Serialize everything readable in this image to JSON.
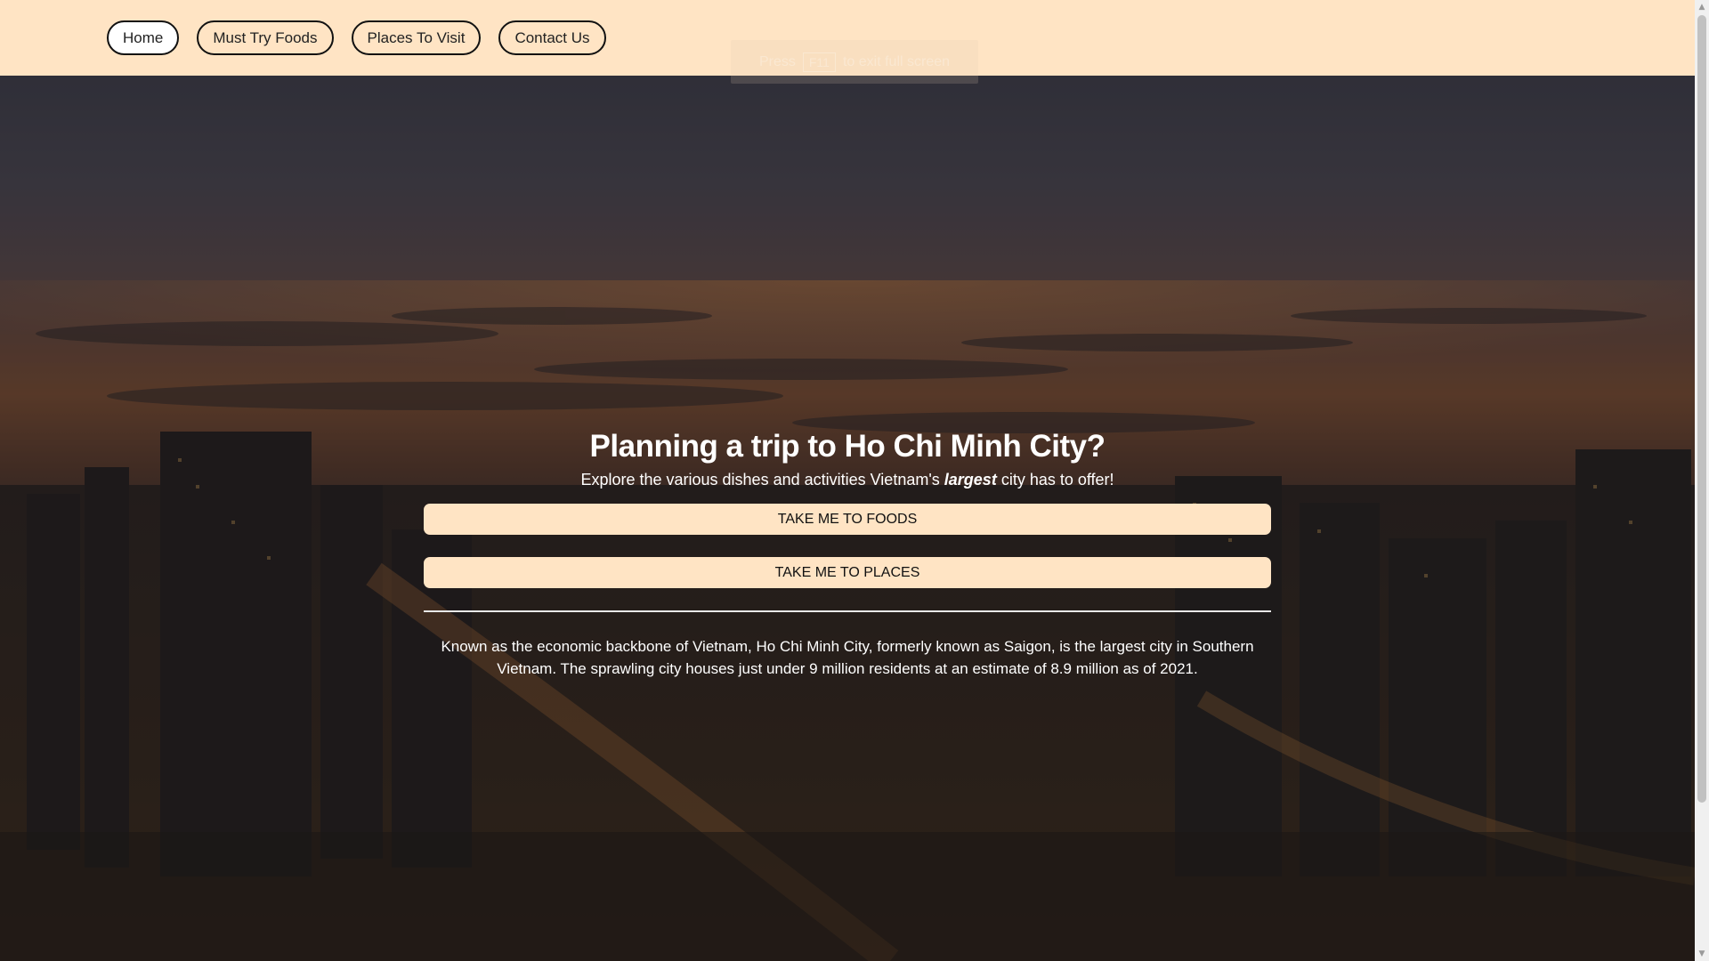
{
  "nav": {
    "items": [
      {
        "label": "Home",
        "active": true
      },
      {
        "label": "Must Try Foods",
        "active": false
      },
      {
        "label": "Places To Visit",
        "active": false
      },
      {
        "label": "Contact Us",
        "active": false
      }
    ]
  },
  "fullscreen_hint": {
    "press": "Press",
    "key": "F11",
    "rest": "to exit full screen"
  },
  "hero": {
    "title": "Planning a trip to Ho Chi Minh City?",
    "subtitle_before": "Explore the various dishes and activities Vietnam's ",
    "subtitle_emphasis": "largest",
    "subtitle_after": " city has to offer!",
    "foods_button": "TAKE ME TO FOODS",
    "places_button": "TAKE ME TO PLACES",
    "description": "Known as the economic backbone of Vietnam, Ho Chi Minh City, formerly known as Saigon, is the largest city in Southern Vietnam. The sprawling city houses just under 9 million residents at an estimate of 8.9 million as of 2021."
  },
  "colors": {
    "navbar_bg": "#ffe4c4",
    "button_bg": "#ffe4c4",
    "text_on_hero": "#ffffff"
  },
  "icons": {
    "scroll_up": "scroll-up-arrow-icon",
    "scroll_down": "scroll-down-arrow-icon"
  }
}
